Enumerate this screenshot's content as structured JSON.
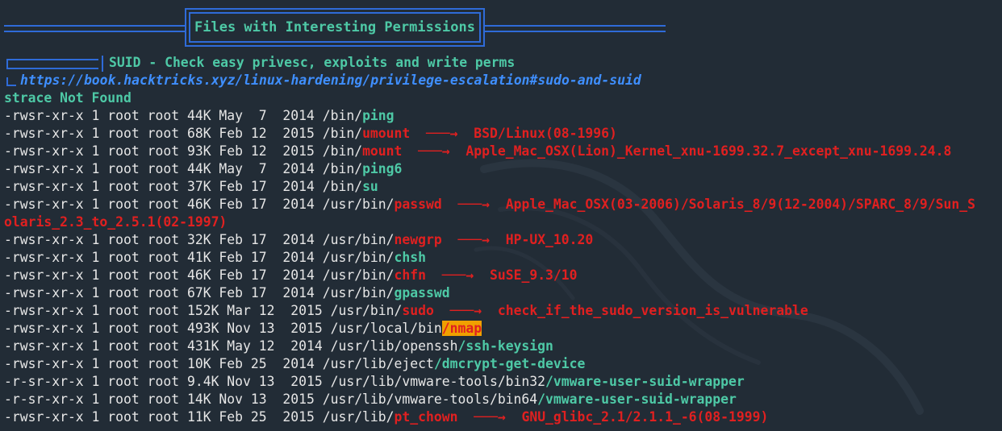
{
  "banner": {
    "title": "Files with Interesting Permissions"
  },
  "section": {
    "title": "SUID - Check easy privesc, exploits and write perms",
    "link": "https://book.hacktricks.xyz/linux-hardening/privilege-escalation#sudo-and-suid"
  },
  "status": {
    "not_found": "strace Not Found"
  },
  "colors": {
    "background": "#222c36",
    "accent_blue": "#2f6bd8",
    "link_blue": "#3f8fff",
    "green": "#4ec9a6",
    "red": "#e02020",
    "highlight": "#f0a000"
  },
  "files": [
    {
      "prefix": "-rwsr-xr-x 1 root root 44K May  7  2014 /bin/",
      "name": "ping",
      "style": "green",
      "arrow": "",
      "exploit": ""
    },
    {
      "prefix": "-rwsr-xr-x 1 root root 68K Feb 12  2015 /bin/",
      "name": "umount",
      "style": "red",
      "arrow": "  --->  ",
      "exploit": "BSD/Linux(08-1996)"
    },
    {
      "prefix": "-rwsr-xr-x 1 root root 93K Feb 12  2015 /bin/",
      "name": "mount",
      "style": "red",
      "arrow": "  --->  ",
      "exploit": "Apple_Mac_OSX(Lion)_Kernel_xnu-1699.32.7_except_xnu-1699.24.8"
    },
    {
      "prefix": "-rwsr-xr-x 1 root root 44K May  7  2014 /bin/",
      "name": "ping6",
      "style": "green",
      "arrow": "",
      "exploit": ""
    },
    {
      "prefix": "-rwsr-xr-x 1 root root 37K Feb 17  2014 /bin/",
      "name": "su",
      "style": "green",
      "arrow": "",
      "exploit": ""
    },
    {
      "prefix": "-rwsr-xr-x 1 root root 46K Feb 17  2014 /usr/bin/",
      "name": "passwd",
      "style": "red",
      "arrow": "  --->  ",
      "exploit": "Apple_Mac_OSX(03-2006)/Solaris_8/9(12-2004)/SPARC_8/9/Sun_S",
      "exploit_cont": "olaris_2.3_to_2.5.1(02-1997)"
    },
    {
      "prefix": "-rwsr-xr-x 1 root root 32K Feb 17  2014 /usr/bin/",
      "name": "newgrp",
      "style": "red",
      "arrow": "  --->  ",
      "exploit": "HP-UX_10.20"
    },
    {
      "prefix": "-rwsr-xr-x 1 root root 41K Feb 17  2014 /usr/bin/",
      "name": "chsh",
      "style": "green",
      "arrow": "",
      "exploit": ""
    },
    {
      "prefix": "-rwsr-xr-x 1 root root 46K Feb 17  2014 /usr/bin/",
      "name": "chfn",
      "style": "red",
      "arrow": "  --->  ",
      "exploit": "SuSE_9.3/10"
    },
    {
      "prefix": "-rwsr-xr-x 1 root root 67K Feb 17  2014 /usr/bin/",
      "name": "gpasswd",
      "style": "green",
      "arrow": "",
      "exploit": ""
    },
    {
      "prefix": "-rwsr-xr-x 1 root root 152K Mar 12  2015 /usr/bin/",
      "name": "sudo",
      "style": "red",
      "arrow": "  --->  ",
      "exploit": "check_if_the_sudo_version_is_vulnerable"
    },
    {
      "prefix": "-rwsr-xr-x 1 root root 493K Nov 13  2015 /usr/local/bin",
      "name": "/nmap",
      "style": "highlight",
      "arrow": "",
      "exploit": ""
    },
    {
      "prefix": "-rwsr-xr-x 1 root root 431K May 12  2014 /usr/lib/openssh",
      "name": "/ssh-keysign",
      "style": "green",
      "arrow": "",
      "exploit": ""
    },
    {
      "prefix": "-rwsr-xr-x 1 root root 10K Feb 25  2014 /usr/lib/eject",
      "name": "/dmcrypt-get-device",
      "style": "green",
      "arrow": "",
      "exploit": ""
    },
    {
      "prefix": "-r-sr-xr-x 1 root root 9.4K Nov 13  2015 /usr/lib/vmware-tools/bin32",
      "name": "/vmware-user-suid-wrapper",
      "style": "green",
      "arrow": "",
      "exploit": ""
    },
    {
      "prefix": "-r-sr-xr-x 1 root root 14K Nov 13  2015 /usr/lib/vmware-tools/bin64",
      "name": "/vmware-user-suid-wrapper",
      "style": "green",
      "arrow": "",
      "exploit": ""
    },
    {
      "prefix": "-rwsr-xr-x 1 root root 11K Feb 25  2015 /usr/lib/",
      "name": "pt_chown",
      "style": "red",
      "arrow": "  --->  ",
      "exploit": "GNU_glibc_2.1/2.1.1_-6(08-1999)"
    }
  ]
}
